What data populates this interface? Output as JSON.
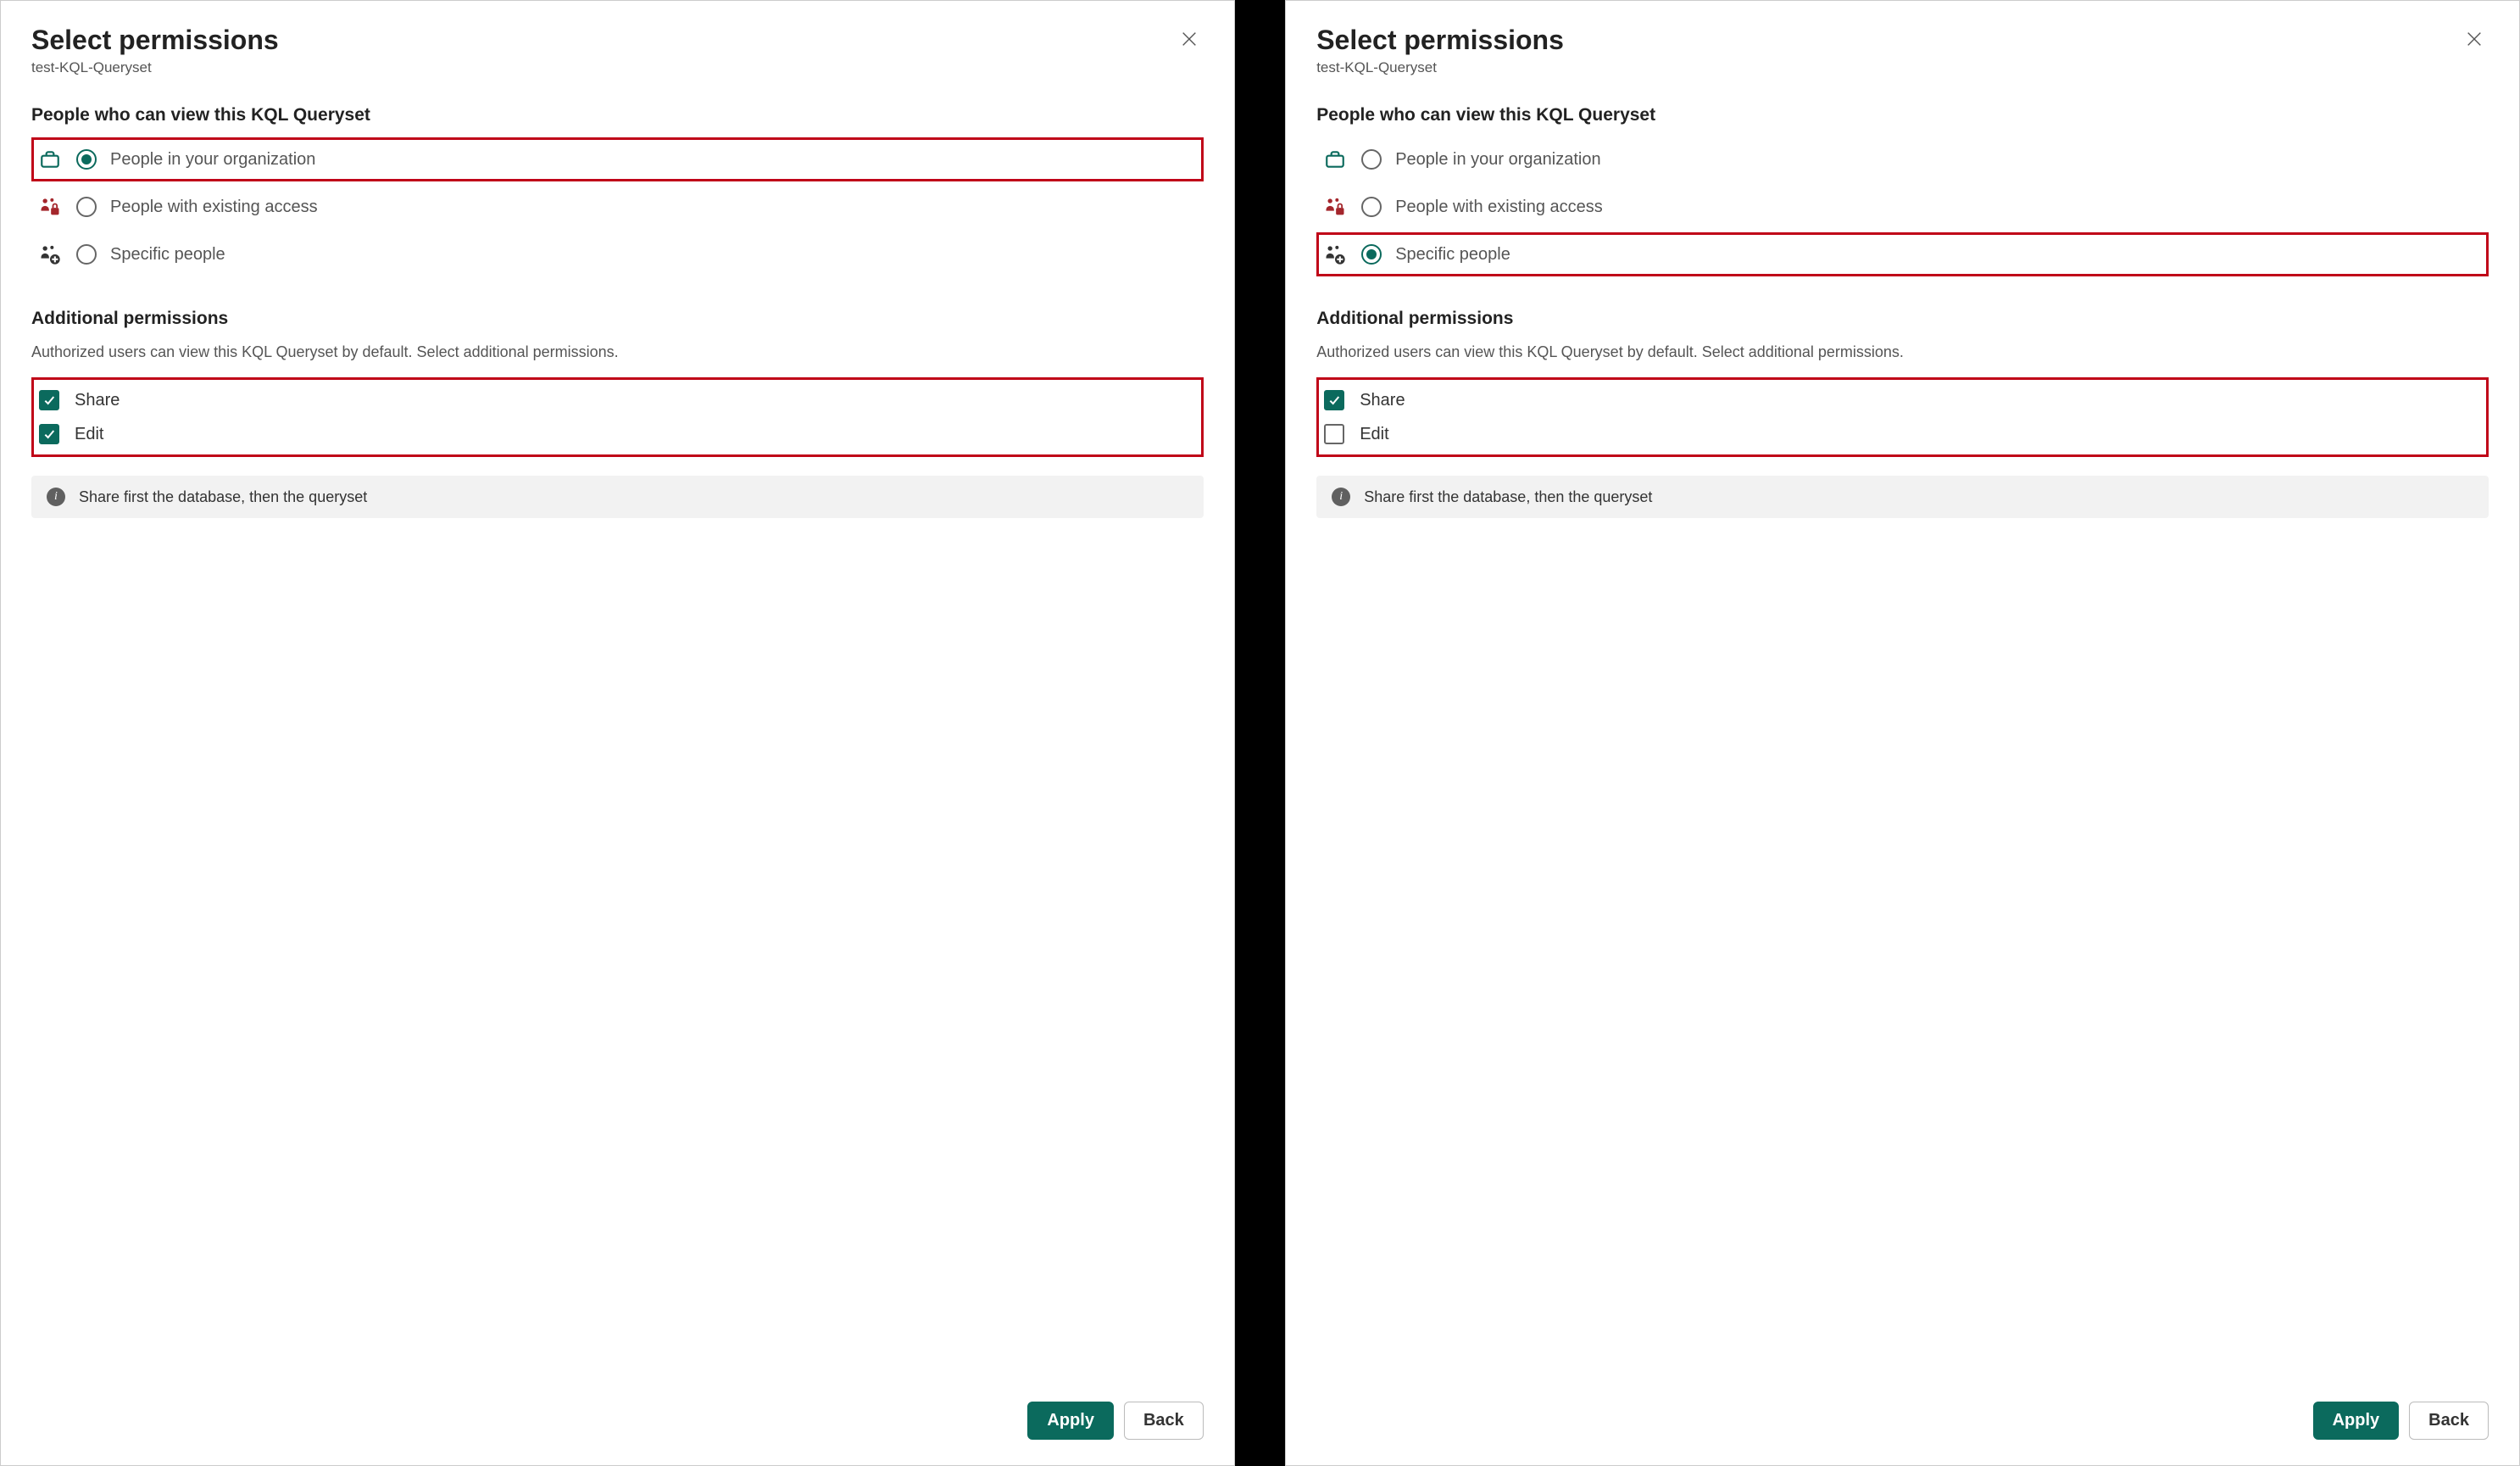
{
  "left": {
    "title": "Select permissions",
    "subtitle": "test-KQL-Queryset",
    "viewers_heading": "People who can view this KQL Queryset",
    "options": {
      "org": "People in your organization",
      "existing": "People with existing access",
      "specific": "Specific people"
    },
    "selected_option": "org",
    "highlighted_option": "org",
    "additional_heading": "Additional permissions",
    "additional_desc": "Authorized users can view this KQL Queryset by default. Select additional permissions.",
    "checks": {
      "share": {
        "label": "Share",
        "checked": true
      },
      "edit": {
        "label": "Edit",
        "checked": true
      }
    },
    "checks_highlight": true,
    "info": "Share first the database, then the queryset",
    "apply": "Apply",
    "back": "Back"
  },
  "right": {
    "title": "Select permissions",
    "subtitle": "test-KQL-Queryset",
    "viewers_heading": "People who can view this KQL Queryset",
    "options": {
      "org": "People in your organization",
      "existing": "People with existing access",
      "specific": "Specific people"
    },
    "selected_option": "specific",
    "highlighted_option": "specific",
    "additional_heading": "Additional permissions",
    "additional_desc": "Authorized users can view this KQL Queryset by default. Select additional permissions.",
    "checks": {
      "share": {
        "label": "Share",
        "checked": true
      },
      "edit": {
        "label": "Edit",
        "checked": false
      }
    },
    "checks_highlight": true,
    "info": "Share first the database, then the queryset",
    "apply": "Apply",
    "back": "Back"
  }
}
